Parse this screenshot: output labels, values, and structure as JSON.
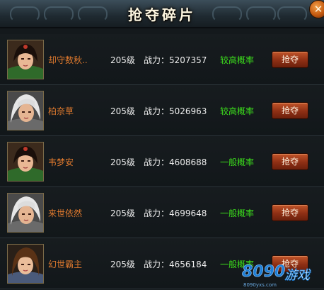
{
  "window": {
    "title": "抢夺碎片",
    "close_glyph": "✕"
  },
  "rows": [
    {
      "name": "却守数秋..",
      "level": "205级",
      "power": "战力：5207357",
      "rate": "较高概率",
      "button": "抢夺",
      "avatar": "female-warrior-avatar"
    },
    {
      "name": "柏奈草",
      "level": "205级",
      "power": "战力：5026963",
      "rate": "较高概率",
      "button": "抢夺",
      "avatar": "silver-hair-avatar"
    },
    {
      "name": "韦梦安",
      "level": "205级",
      "power": "战力：4608688",
      "rate": "一般概率",
      "button": "抢夺",
      "avatar": "female-warrior-avatar"
    },
    {
      "name": "来世依然",
      "level": "205级",
      "power": "战力：4699648",
      "rate": "一般概率",
      "button": "抢夺",
      "avatar": "silver-hair-avatar"
    },
    {
      "name": "幻世霸主",
      "level": "205级",
      "power": "战力：4656184",
      "rate": "一般概率",
      "button": "抢夺",
      "avatar": "brown-hair-avatar"
    }
  ],
  "watermark": {
    "logo": "8090",
    "tag": "游戏",
    "url": "8090yxs.com"
  },
  "colors": {
    "name": "#e07a2e",
    "rate": "#3de21c",
    "button": "#8e2f14"
  }
}
